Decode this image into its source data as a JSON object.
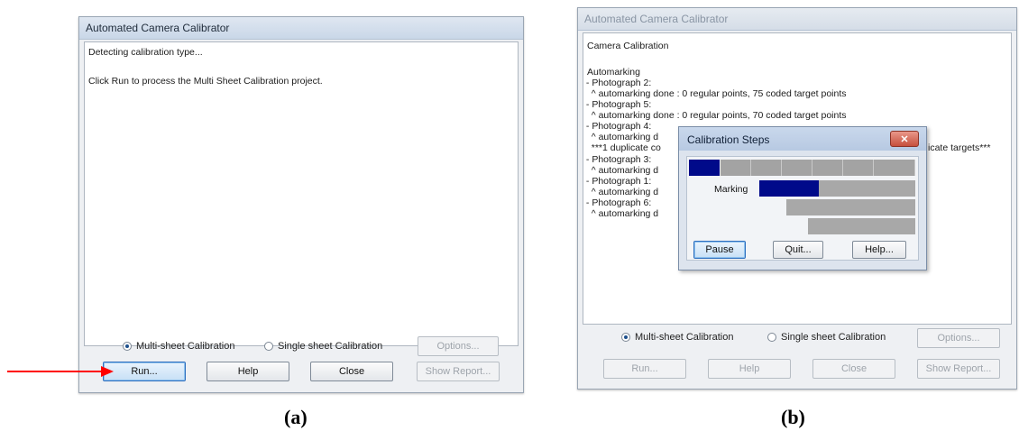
{
  "left_window": {
    "title": "Automated Camera Calibrator",
    "lines": [
      "Detecting calibration type...",
      "Click Run to process the Multi Sheet Calibration project."
    ],
    "radio_multi_label": "Multi-sheet Calibration",
    "radio_single_label": "Single sheet Calibration",
    "selected_mode": "Multi-sheet Calibration",
    "options_label": "Options...",
    "run_label": "Run...",
    "help_label": "Help",
    "close_label": "Close",
    "report_label": "Show Report..."
  },
  "right_window": {
    "title": "Automated Camera Calibrator",
    "lines": [
      "Camera Calibration",
      "",
      "Automarking",
      " - Photograph 2:",
      "   ^ automarking done : 0 regular points, 75 coded target points",
      " - Photograph 5:",
      "   ^ automarking done : 0 regular points, 70 coded target points",
      " - Photograph 4:",
      "   ^ automarking d",
      "   ***1 duplicate co",
      " - Photograph 3:",
      "   ^ automarking d",
      " - Photograph 1:",
      "   ^ automarking d",
      " - Photograph 6:",
      "   ^ automarking d"
    ],
    "dup_tail": "icate targets***",
    "radio_multi_label": "Multi-sheet Calibration",
    "radio_single_label": "Single sheet Calibration",
    "selected_mode": "Multi-sheet Calibration",
    "options_label": "Options...",
    "run_label": "Run...",
    "help_label": "Help",
    "close_label": "Close",
    "report_label": "Show Report..."
  },
  "steps_dialog": {
    "title": "Calibration Steps",
    "step_label": "Marking",
    "pause_label": "Pause",
    "quit_label": "Quit...",
    "help_label": "Help..."
  },
  "captions": {
    "a": "(a)",
    "b": "(b)"
  },
  "colors": {
    "arrow": "#ff0000",
    "progress_fill": "#000a8a"
  }
}
